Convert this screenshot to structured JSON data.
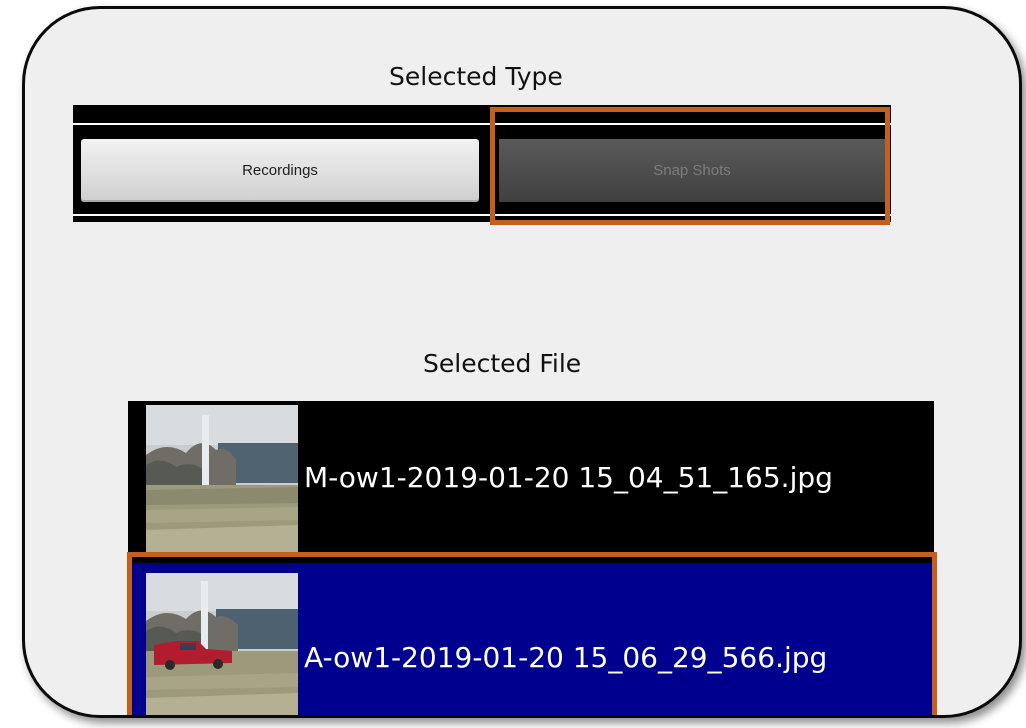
{
  "sections": {
    "type_heading": "Selected Type",
    "file_heading": "Selected File"
  },
  "type_selector": {
    "options": [
      {
        "label": "Recordings",
        "selected": false
      },
      {
        "label": "Snap Shots",
        "selected": true
      }
    ]
  },
  "files": {
    "items": [
      {
        "name": "M-ow1-2019-01-20 15_04_51_165.jpg",
        "selected": false
      },
      {
        "name": "A-ow1-2019-01-20 15_06_29_566.jpg",
        "selected": true
      }
    ]
  },
  "colors": {
    "highlight": "#c45f1d",
    "selected_row": "#00008e",
    "list_background": "#000000"
  }
}
